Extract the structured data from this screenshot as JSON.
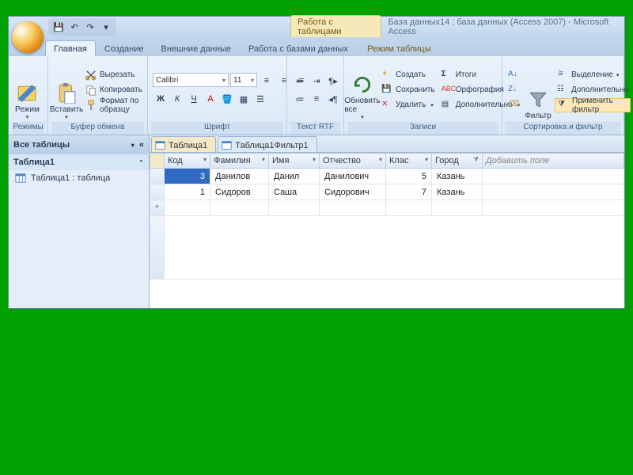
{
  "title_context": "Работа с таблицами",
  "title_file": "База данных14 : база данных (Access 2007) - Microsoft Access",
  "tabs": {
    "home": "Главная",
    "create": "Создание",
    "external": "Внешние данные",
    "dbtools": "Работа с базами данных",
    "datasheet": "Режим таблицы"
  },
  "ribbon": {
    "views_label": "Режимы",
    "view_btn": "Режим",
    "clipboard_label": "Буфер обмена",
    "paste_btn": "Вставить",
    "cut": "Вырезать",
    "copy": "Копировать",
    "format_painter": "Формат по образцу",
    "font_label": "Шрифт",
    "font_name": "Calibri",
    "font_size": "11",
    "rtf_label": "Текст RTF",
    "records_label": "Записи",
    "refresh_btn": "Обновить все",
    "new_rec": "Создать",
    "save_rec": "Сохранить",
    "delete_rec": "Удалить",
    "totals": "Итоги",
    "spelling": "Орфография",
    "more": "Дополнительно",
    "sortfilter_label": "Сортировка и фильтр",
    "filter_btn": "Фильтр",
    "selection": "Выделение",
    "advanced": "Дополнительно",
    "toggle_filter": "Применить фильтр"
  },
  "nav": {
    "header": "Все таблицы",
    "group": "Таблица1",
    "item": "Таблица1 : таблица"
  },
  "doctabs": {
    "t1": "Таблица1",
    "t2": "Таблица1Фильтр1"
  },
  "columns": {
    "id": "Код",
    "surname": "Фамилия",
    "name": "Имя",
    "patronymic": "Отчество",
    "class": "Клас",
    "city": "Город",
    "add": "Добавить поле"
  },
  "rows": [
    {
      "id": "3",
      "surname": "Данилов",
      "name": "Данил",
      "patronymic": "Данилович",
      "class": "5",
      "city": "Казань"
    },
    {
      "id": "1",
      "surname": "Сидоров",
      "name": "Саша",
      "patronymic": "Сидорович",
      "class": "7",
      "city": "Казань"
    }
  ]
}
